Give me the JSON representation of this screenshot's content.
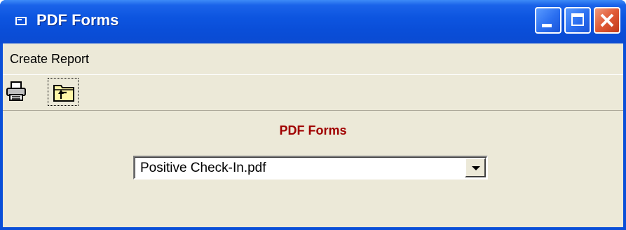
{
  "window": {
    "title": "PDF Forms",
    "controls": {
      "minimize": "minimize",
      "maximize": "maximize",
      "close": "close"
    }
  },
  "menubar": {
    "items": [
      {
        "label": "Create Report"
      }
    ]
  },
  "toolbar": {
    "buttons": [
      {
        "icon": "printer-icon"
      },
      {
        "icon": "folder-up-icon"
      }
    ]
  },
  "form": {
    "heading": "PDF Forms",
    "heading_color": "#a00000",
    "file_select": {
      "value": "Positive Check-In.pdf"
    }
  },
  "colors": {
    "titlebar": "#0a4ed8",
    "client_background": "#ece9d8",
    "close_button": "#e05a35"
  }
}
